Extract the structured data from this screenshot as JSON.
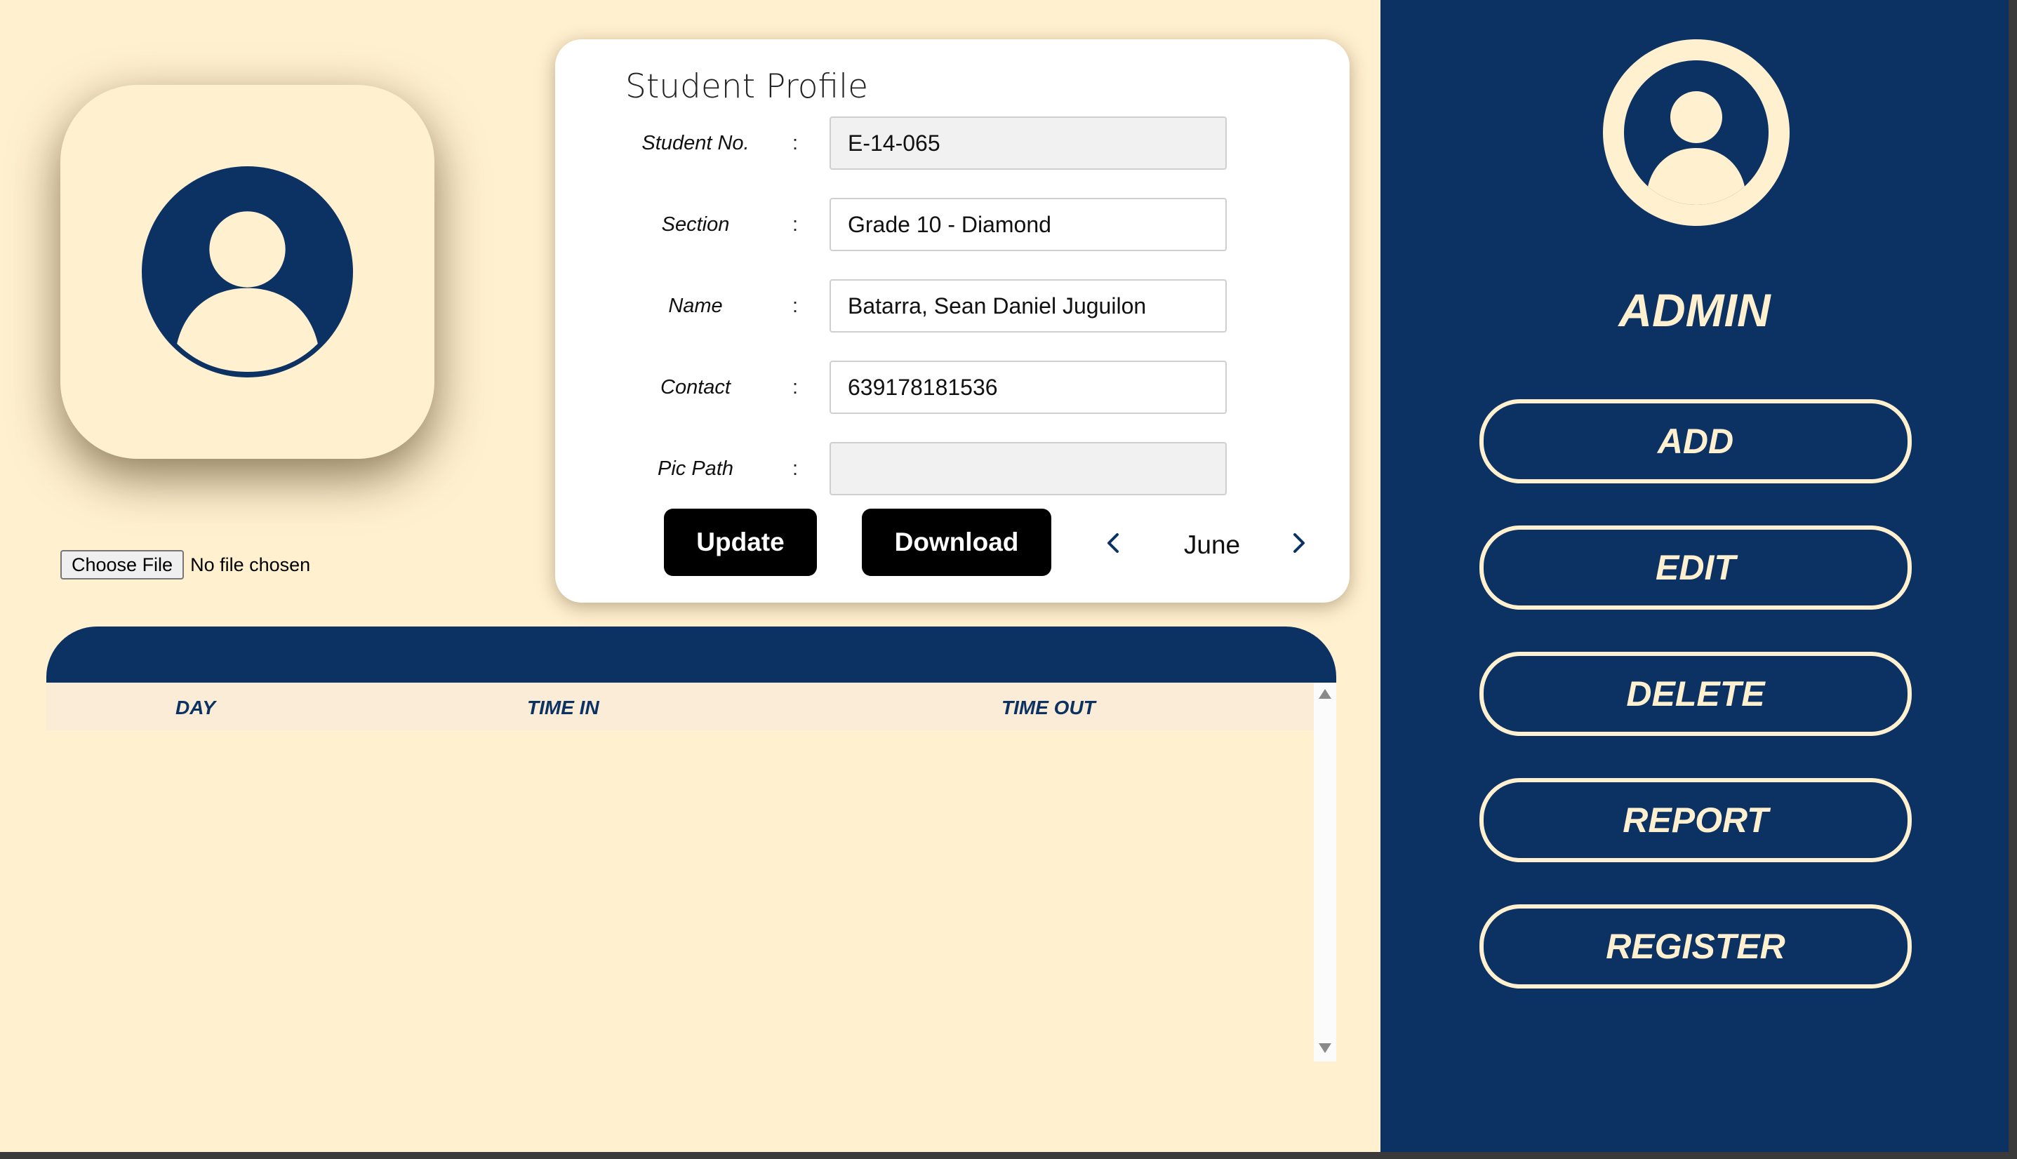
{
  "colors": {
    "navy": "#0c3264",
    "cream": "#fff0cf",
    "white": "#ffffff",
    "black": "#000000"
  },
  "photo": {
    "icon": "user-avatar-icon"
  },
  "file_input": {
    "button_label": "Choose File",
    "status": "No file chosen"
  },
  "profile": {
    "title": "Student Profile",
    "fields": [
      {
        "label": "Student No.",
        "colon": ":",
        "value": "E-14-065",
        "readonly": true
      },
      {
        "label": "Section",
        "colon": ":",
        "value": "Grade 10 - Diamond",
        "readonly": false
      },
      {
        "label": "Name",
        "colon": ":",
        "value": "Batarra, Sean Daniel Juguilon",
        "readonly": false
      },
      {
        "label": "Contact",
        "colon": ":",
        "value": "639178181536",
        "readonly": false
      },
      {
        "label": "Pic Path",
        "colon": ":",
        "value": "",
        "readonly": true
      }
    ],
    "update_label": "Update",
    "download_label": "Download",
    "month": {
      "label": "June",
      "prev_icon": "chevron-left-icon",
      "next_icon": "chevron-right-icon"
    }
  },
  "attendance_table": {
    "columns": [
      "DAY",
      "TIME IN",
      "TIME OUT"
    ],
    "rows": []
  },
  "sidebar": {
    "avatar_icon": "user-avatar-icon",
    "role": "ADMIN",
    "buttons": [
      "ADD",
      "EDIT",
      "DELETE",
      "REPORT",
      "REGISTER"
    ]
  }
}
